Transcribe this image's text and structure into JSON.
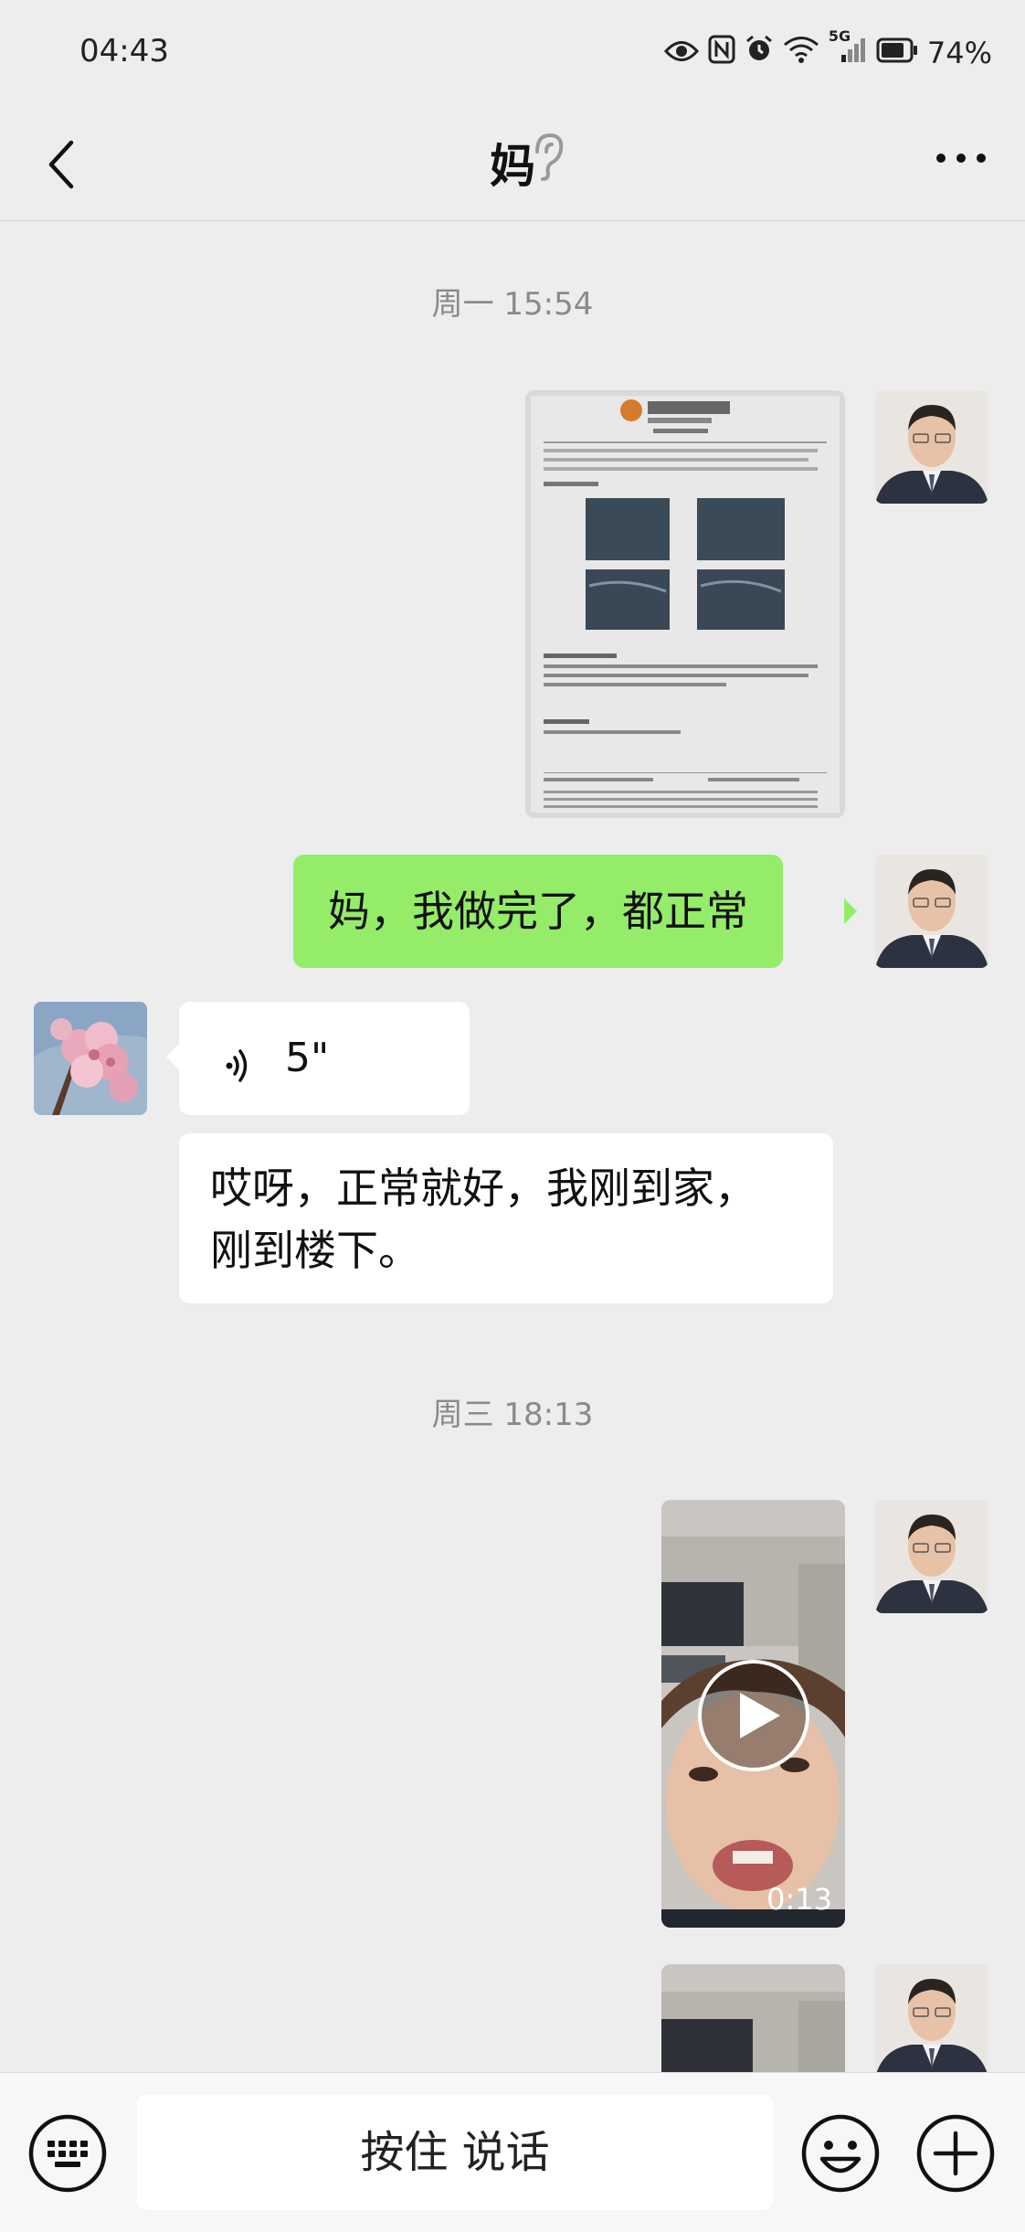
{
  "status_bar": {
    "time": "04:43",
    "network": "5G",
    "battery": "74%"
  },
  "header": {
    "title": "妈"
  },
  "messages": [
    {
      "type": "time",
      "text": "周一 15:54"
    },
    {
      "type": "image",
      "sender": "me"
    },
    {
      "type": "text",
      "sender": "me",
      "text": "妈，我做完了，都正常"
    },
    {
      "type": "voice",
      "sender": "mom",
      "duration": "5\""
    },
    {
      "type": "text",
      "sender": "mom",
      "lines": [
        "哎呀，正常就好，我刚到家，",
        "刚到楼下。"
      ]
    },
    {
      "type": "time",
      "text": "周三 18:13"
    },
    {
      "type": "video",
      "sender": "me",
      "duration": "0:13"
    },
    {
      "type": "video",
      "sender": "me"
    }
  ],
  "input_bar": {
    "hold_to_talk": "按住 说话"
  },
  "colors": {
    "background": "#ededed",
    "my_bubble": "#95ec69",
    "other_bubble": "#ffffff"
  }
}
